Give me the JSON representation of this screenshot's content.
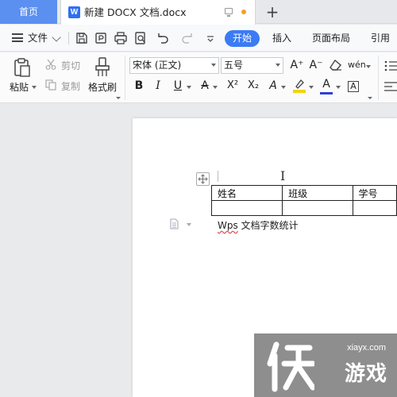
{
  "tabs": {
    "home_label": "首页",
    "doc_icon_letter": "W",
    "doc_title": "新建 DOCX 文档.docx",
    "new_tab_symbol": "+"
  },
  "menu": {
    "file_label": "文件",
    "ribbon_tabs": [
      "开始",
      "插入",
      "页面布局",
      "引用"
    ]
  },
  "ribbon": {
    "paste": "粘贴",
    "cut": "剪切",
    "copy": "复制",
    "format_painter": "格式刷",
    "font_name": "宋体 (正文)",
    "font_size": "五号",
    "grow_font": "A⁺",
    "shrink_font": "A⁻",
    "phonetic": "wén",
    "bold": "B",
    "italic": "I",
    "underline": "U",
    "strike": "A",
    "superscript": "X²",
    "subscript": "X₂",
    "text_effect": "A",
    "font_color": "A",
    "char_border": "A",
    "highlight_color": "#f5d300",
    "font_color_value": "#2b3fd6"
  },
  "document": {
    "table_headers": [
      "姓名",
      "班级",
      "学号"
    ],
    "paragraph_prefix": "Wps",
    "paragraph_rest": " 文档字数统计"
  },
  "watermark": {
    "url": "xiayx.com",
    "label": "游戏"
  }
}
